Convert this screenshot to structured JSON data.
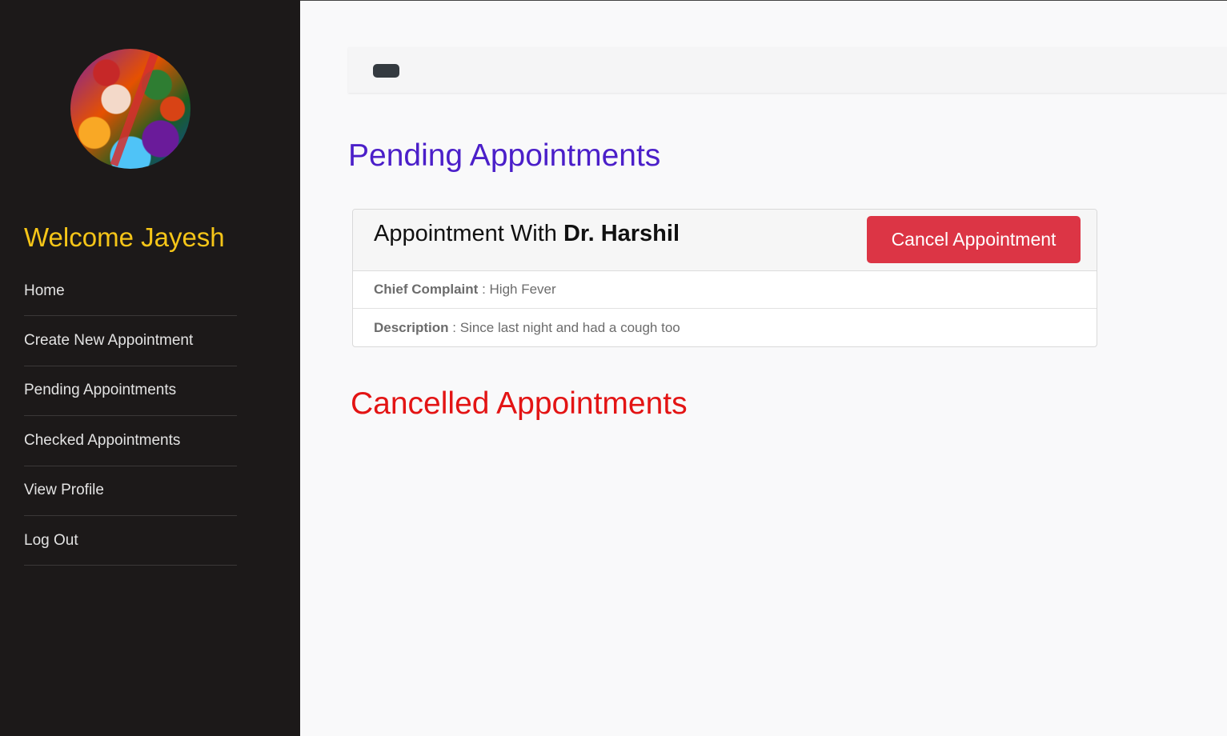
{
  "sidebar": {
    "welcome": "Welcome Jayesh",
    "nav": [
      {
        "label": "Home"
      },
      {
        "label": "Create New Appointment"
      },
      {
        "label": "Pending Appointments"
      },
      {
        "label": "Checked Appointments"
      },
      {
        "label": "View Profile"
      },
      {
        "label": "Log Out"
      }
    ]
  },
  "main": {
    "pending_title": "Pending Appointments",
    "appointment": {
      "title_prefix": "Appointment With ",
      "doctor": "Dr. Harshil",
      "cancel_label": "Cancel Appointment",
      "complaint_label": "Chief Complaint",
      "complaint_sep": " : ",
      "complaint_value": "High Fever",
      "description_label": "Description",
      "description_sep": " : ",
      "description_value": "Since last night and had a cough too"
    },
    "cancelled_title": "Cancelled Appointments"
  },
  "colors": {
    "sidebar_bg": "#1c1919",
    "welcome": "#f5c518",
    "pending_title": "#4b1fc9",
    "cancelled_title": "#e31414",
    "cancel_button": "#dc3545"
  }
}
